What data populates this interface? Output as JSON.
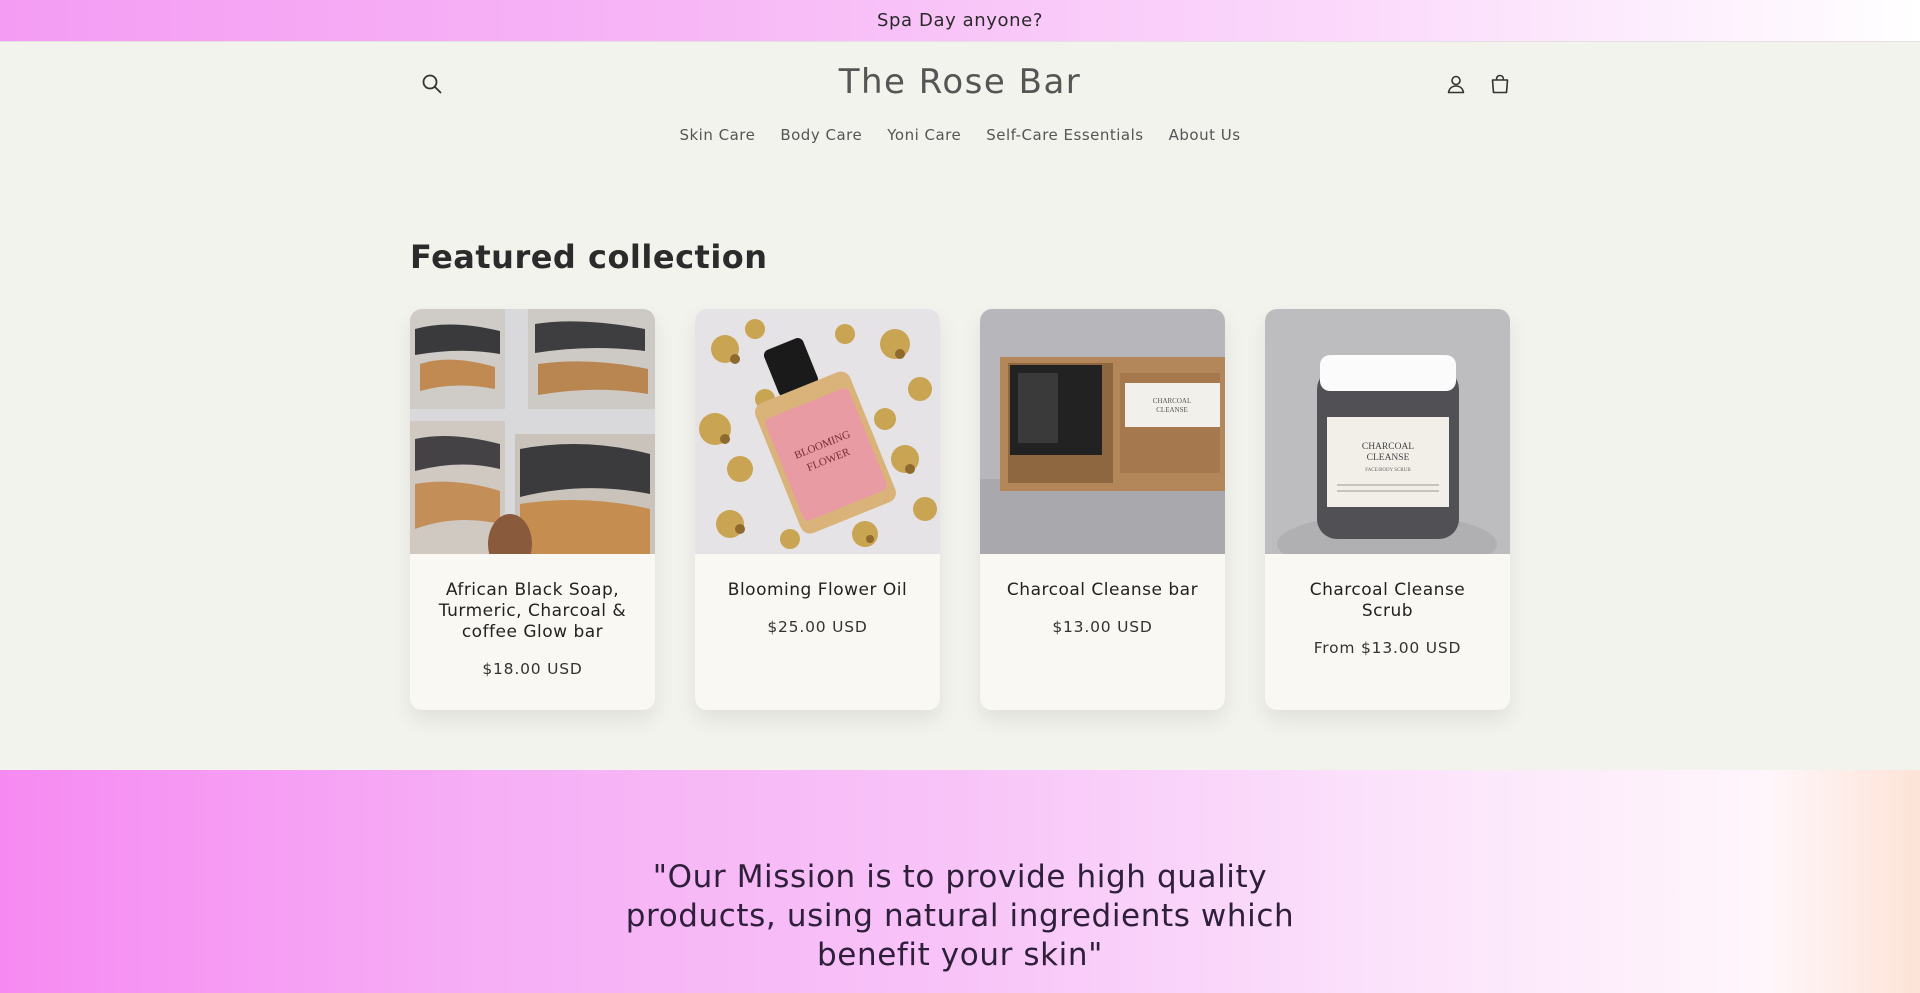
{
  "announcement": {
    "text": "Spa Day anyone?"
  },
  "header": {
    "logo": "The Rose Bar",
    "icons": {
      "search": "search-icon",
      "account": "user-icon",
      "cart": "cart-icon"
    }
  },
  "nav": {
    "items": [
      {
        "label": "Skin Care"
      },
      {
        "label": "Body Care"
      },
      {
        "label": "Yoni Care"
      },
      {
        "label": "Self-Care Essentials"
      },
      {
        "label": "About Us"
      }
    ]
  },
  "featured": {
    "title": "Featured collection",
    "products": [
      {
        "title": "African Black Soap, Turmeric, Charcoal & coffee Glow bar",
        "price": "$18.00 USD"
      },
      {
        "title": "Blooming Flower Oil",
        "price": "$25.00 USD"
      },
      {
        "title": "Charcoal Cleanse bar",
        "price": "$13.00 USD"
      },
      {
        "title": "Charcoal Cleanse Scrub",
        "price": "From $13.00 USD"
      }
    ]
  },
  "mission": {
    "text": "\"Our Mission is to provide high quality products, using natural ingredients which benefit your skin\""
  },
  "colors": {
    "announcement_gradient_start": "#f49cf3",
    "mission_gradient_start": "#f68af2",
    "page_background": "#f3f3ee",
    "card_background": "#faf8f2"
  }
}
